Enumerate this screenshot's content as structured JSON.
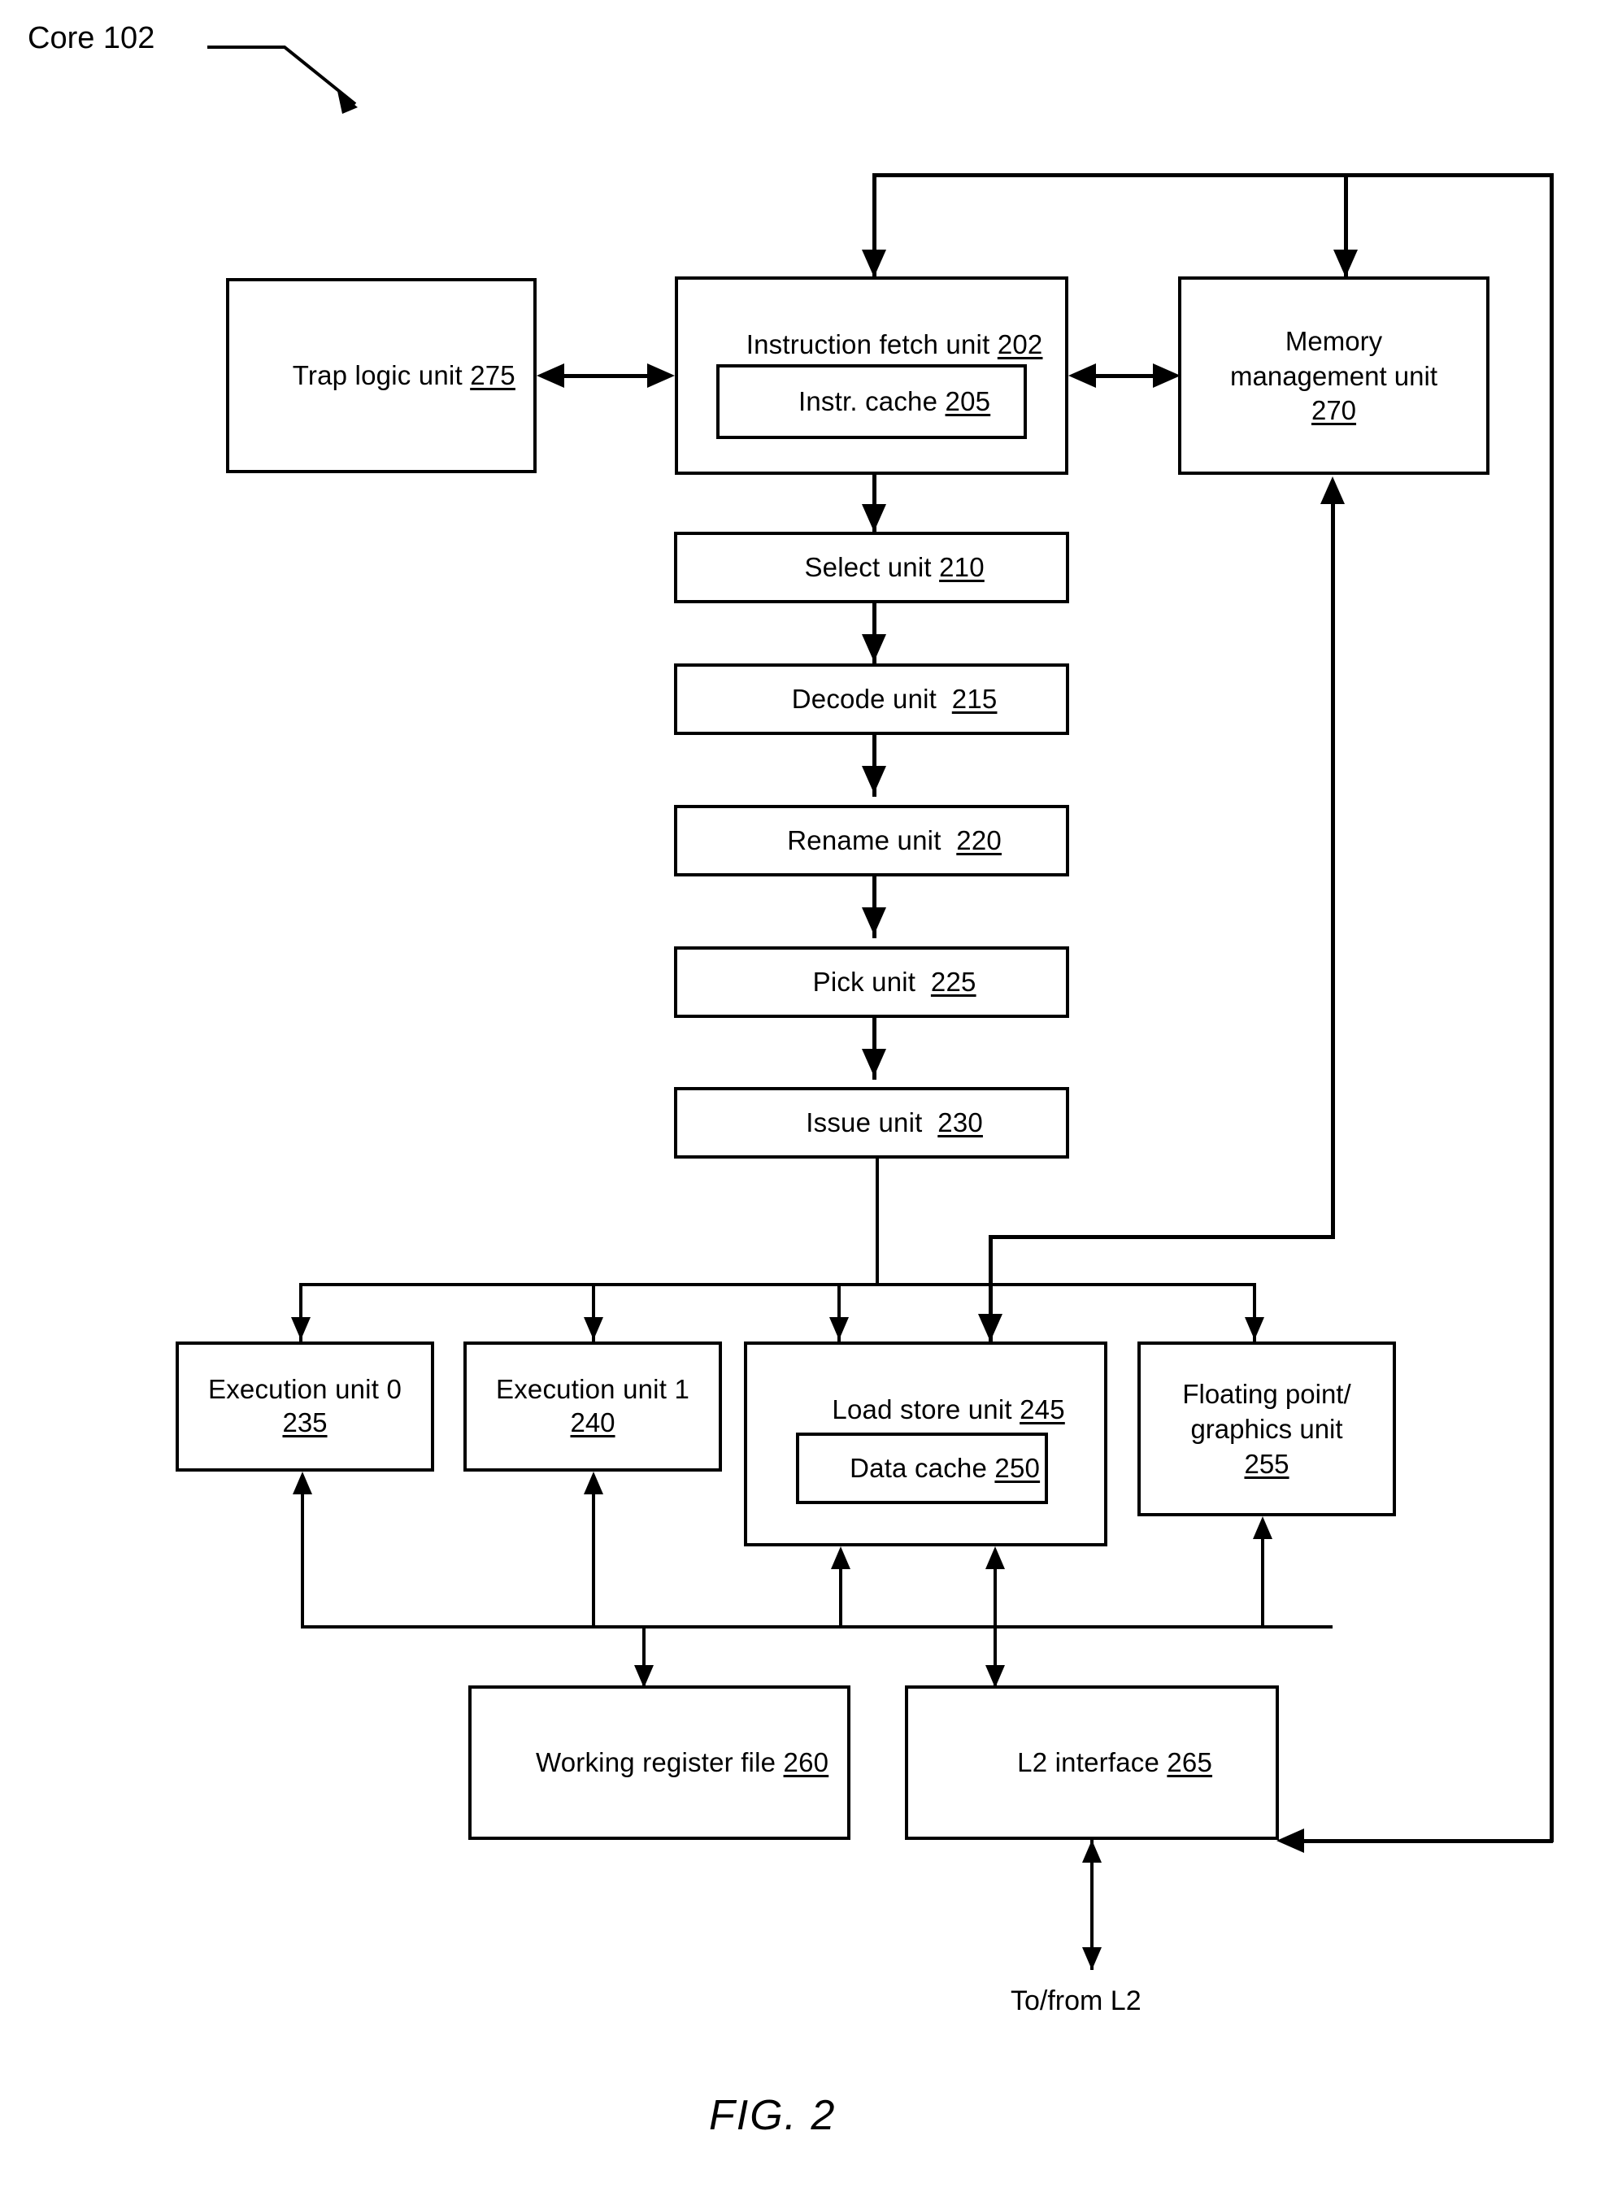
{
  "figure": {
    "caption": "FIG. 2",
    "core_label": "Core 102"
  },
  "blocks": {
    "trap_logic": {
      "label": "Trap logic unit ",
      "ref": "275"
    },
    "instruction_fetch": {
      "label": "Instruction fetch unit ",
      "ref": "202"
    },
    "instr_cache": {
      "label": "Instr. cache ",
      "ref": "205"
    },
    "memory_management": {
      "label": "Memory\nmanagement unit",
      "ref": "270"
    },
    "select_unit": {
      "label": "Select unit ",
      "ref": "210"
    },
    "decode_unit": {
      "label": "Decode unit  ",
      "ref": "215"
    },
    "rename_unit": {
      "label": "Rename unit  ",
      "ref": "220"
    },
    "pick_unit": {
      "label": "Pick unit  ",
      "ref": "225"
    },
    "issue_unit": {
      "label": "Issue unit  ",
      "ref": "230"
    },
    "execution_unit_0": {
      "label": "Execution unit 0",
      "ref": "235"
    },
    "execution_unit_1": {
      "label": "Execution unit 1",
      "ref": "240"
    },
    "load_store_unit": {
      "label": "Load store unit ",
      "ref": "245"
    },
    "data_cache": {
      "label": "Data cache ",
      "ref": "250"
    },
    "floating_point_graphics": {
      "label": "Floating point/\ngraphics unit",
      "ref": "255"
    },
    "working_register_file": {
      "label": "Working register file ",
      "ref": "260"
    },
    "l2_interface": {
      "label": "L2 interface ",
      "ref": "265"
    }
  },
  "annotations": {
    "to_from_l2": "To/from L2"
  },
  "colors": {
    "line": "#000000",
    "background": "#ffffff"
  }
}
